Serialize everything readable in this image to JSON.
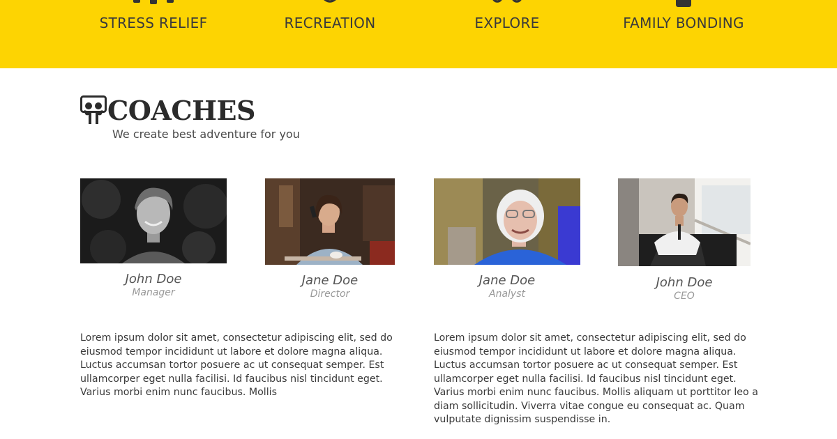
{
  "features": [
    {
      "label": "STRESS RELIEF",
      "icon": "stress-relief-icon"
    },
    {
      "label": "RECREATION",
      "icon": "recreation-icon"
    },
    {
      "label": "EXPLORE",
      "icon": "explore-icon"
    },
    {
      "label": "FAMILY BONDING",
      "icon": "family-bonding-icon"
    }
  ],
  "coaches_section": {
    "title": "COACHES",
    "subtitle": "We create best adventure for you",
    "logo_icon": "slideshare-logo-icon"
  },
  "coaches": [
    {
      "name": "John Doe",
      "role": "Manager"
    },
    {
      "name": "Jane Doe",
      "role": "Director"
    },
    {
      "name": "Jane Doe",
      "role": "Analyst"
    },
    {
      "name": "John Doe",
      "role": "CEO"
    }
  ],
  "paragraphs": [
    "Lorem ipsum dolor sit amet, consectetur adipiscing elit, sed do eiusmod tempor incididunt ut labore et dolore magna aliqua. Luctus accumsan tortor posuere ac ut consequat semper. Est ullamcorper eget nulla facilisi. Id faucibus nisl tincidunt eget. Varius morbi enim nunc faucibus. Mollis",
    "Lorem ipsum dolor sit amet, consectetur adipiscing elit, sed do eiusmod tempor incididunt ut labore et dolore magna aliqua. Luctus accumsan tortor posuere ac ut consequat semper. Est ullamcorper eget nulla facilisi. Id faucibus nisl tincidunt eget. Varius morbi enim nunc faucibus. Mollis aliquam ut porttitor leo a diam sollicitudin. Viverra vitae congue eu consequat ac. Quam vulputate dignissim suspendisse in."
  ],
  "colors": {
    "band": "#fdd402",
    "heading": "#2b2b2b",
    "text": "#3a3a3a",
    "role": "#999999"
  }
}
